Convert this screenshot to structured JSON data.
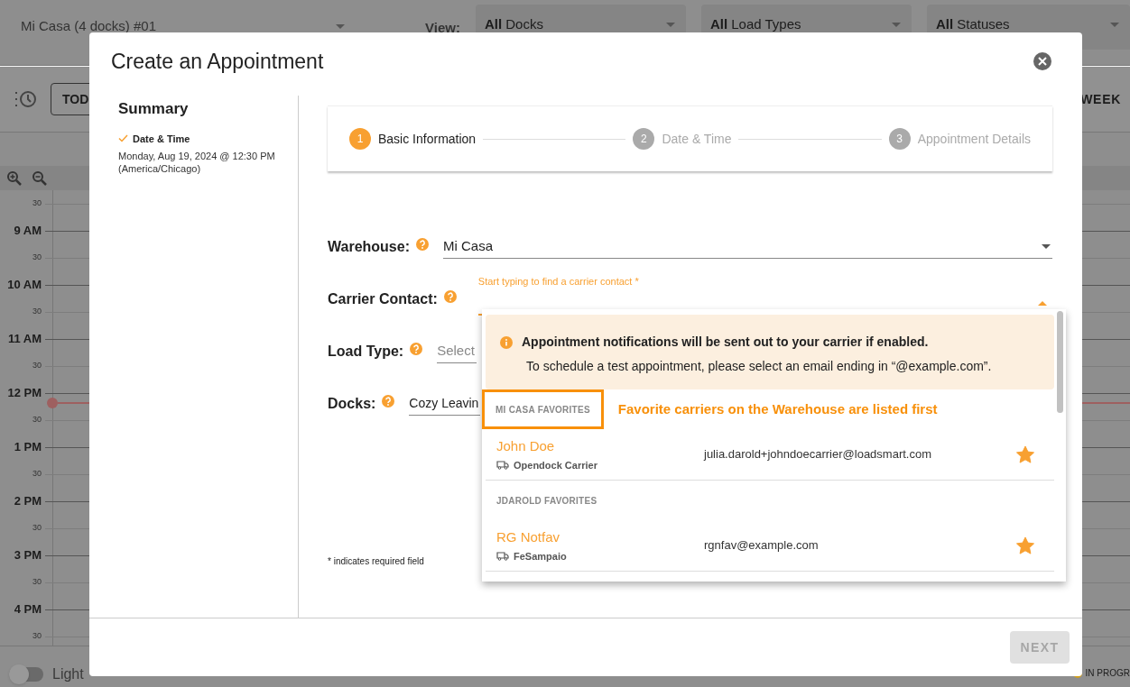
{
  "background": {
    "location": "Mi Casa (4 docks) #01",
    "view_label": "View:",
    "filters": [
      "**All** Docks",
      "**All** Load Types",
      "**All** Statuses"
    ],
    "today_button": "TOD",
    "week_button": "WEEK",
    "time_labels": [
      "30",
      "9 AM",
      "30",
      "10 AM",
      "30",
      "11 AM",
      "30",
      "12 PM",
      "30",
      "1 PM",
      "30",
      "2 PM",
      "30",
      "3 PM",
      "30",
      "4 PM",
      "30"
    ],
    "theme_toggle": {
      "label": "Light",
      "on": false
    },
    "legend": {
      "label": "IN PROGR",
      "color": "#d4a017"
    }
  },
  "dialog": {
    "title": "Create an Appointment",
    "summary": {
      "title": "Summary",
      "items": [
        {
          "label": "Date & Time",
          "done": true,
          "value": "Monday, Aug 19, 2024 @ 12:30 PM (America/Chicago)"
        }
      ]
    },
    "steps": [
      {
        "number": "1",
        "label": "Basic Information",
        "selected": true
      },
      {
        "number": "2",
        "label": "Date & Time",
        "selected": false
      },
      {
        "number": "3",
        "label": "Appointment Details",
        "selected": false
      }
    ],
    "fields": [
      {
        "label": "Warehouse:",
        "kind": "select",
        "value": "Mi Casa"
      },
      {
        "label": "Carrier Contact:",
        "kind": "autocomplete",
        "floating_label": "Start typing to find a carrier contact *",
        "focused": true
      },
      {
        "label": "Load Type:",
        "kind": "select",
        "placeholder": "Select"
      },
      {
        "label": "Docks:",
        "kind": "select",
        "value": "Cozy Leavin"
      }
    ],
    "required_note": "* indicates required field",
    "dropdown": {
      "notice": {
        "title": "Appointment notifications will be sent out to your carrier if enabled.",
        "text": "To schedule a test appointment, please select an email ending in “@example.com”."
      },
      "groups": [
        {
          "heading": "MI CASA FAVORITES",
          "highlighted": true,
          "contacts": [
            {
              "name": "John Doe",
              "company": "Opendock Carrier",
              "email": "julia.darold+johndoecarrier@loadsmart.com",
              "favorite": true
            }
          ]
        },
        {
          "heading": "JDAROLD FAVORITES",
          "highlighted": false,
          "contacts": [
            {
              "name": "RG Notfav",
              "company": "FeSampaio",
              "email": "rgnfav@example.com",
              "favorite": true
            }
          ]
        }
      ]
    },
    "annotation": "Favorite carriers on the Warehouse are listed first",
    "next_button": {
      "label": "NEXT",
      "disabled": true
    }
  }
}
